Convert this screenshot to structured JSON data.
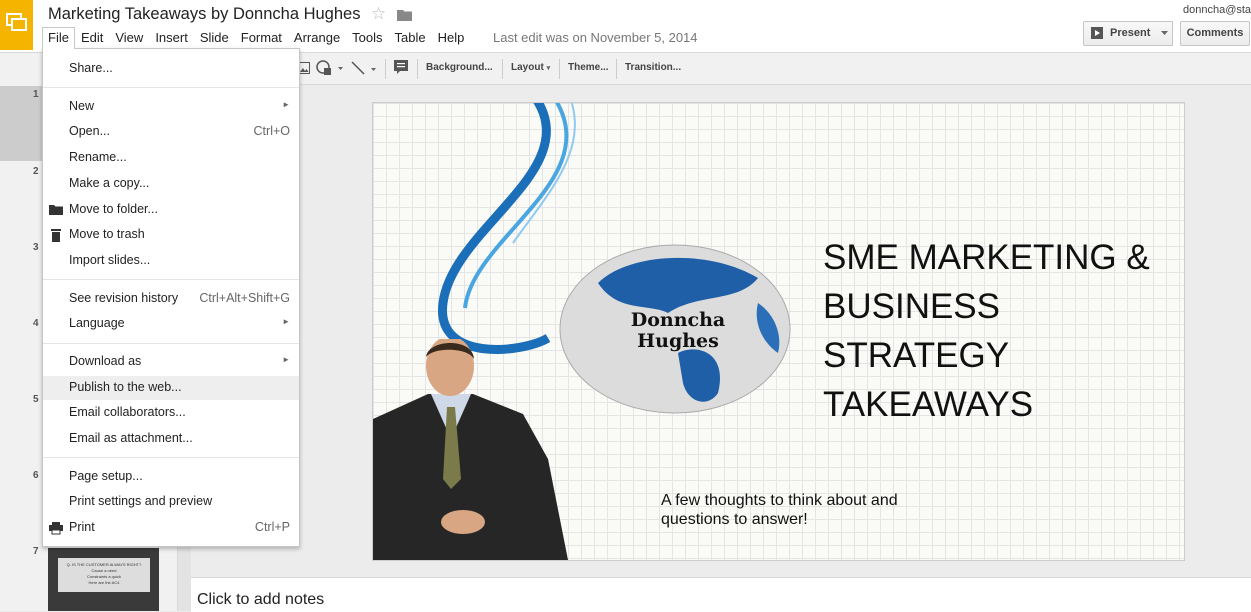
{
  "header": {
    "title": "Marketing Takeaways by Donncha Hughes",
    "last_edit": "Last edit was on November 5, 2014",
    "user_email": "donncha@star",
    "present_label": "Present",
    "comments_label": "Comments"
  },
  "menubar": [
    "File",
    "Edit",
    "View",
    "Insert",
    "Slide",
    "Format",
    "Arrange",
    "Tools",
    "Table",
    "Help"
  ],
  "toolbar": {
    "background_label": "Background...",
    "layout_label": "Layout",
    "theme_label": "Theme...",
    "transition_label": "Transition..."
  },
  "file_menu": {
    "share": "Share...",
    "new": "New",
    "open": "Open...",
    "open_shortcut": "Ctrl+O",
    "rename": "Rename...",
    "make_copy": "Make a copy...",
    "move_to_folder": "Move to folder...",
    "move_to_trash": "Move to trash",
    "import_slides": "Import slides...",
    "revision_history": "See revision history",
    "revision_shortcut": "Ctrl+Alt+Shift+G",
    "language": "Language",
    "download_as": "Download as",
    "publish": "Publish to the web...",
    "email_collaborators": "Email collaborators...",
    "email_attachment": "Email as attachment...",
    "page_setup": "Page setup...",
    "print_settings": "Print settings and preview",
    "print": "Print",
    "print_shortcut": "Ctrl+P"
  },
  "filmstrip": {
    "slide_numbers": [
      "1",
      "2",
      "3",
      "4",
      "5",
      "6",
      "7"
    ],
    "thumb7_lines": [
      "Q. IS THE CUSTOMER ALWAYS RIGHT?",
      "Cause a need",
      "Constraints a quick",
      "Here are the AC4"
    ]
  },
  "slide": {
    "title_lines": [
      "SME MARKETING &",
      "BUSINESS",
      "STRATEGY",
      "TAKEAWAYS"
    ],
    "subtitle_lines": [
      "A few thoughts to think about and",
      "questions to answer!"
    ],
    "globe_text": [
      "Donncha",
      "Hughes"
    ]
  },
  "notes": {
    "placeholder": "Click to add notes"
  },
  "colors": {
    "app_accent": "#f4b400",
    "menu_highlight": "#eeeeee"
  }
}
